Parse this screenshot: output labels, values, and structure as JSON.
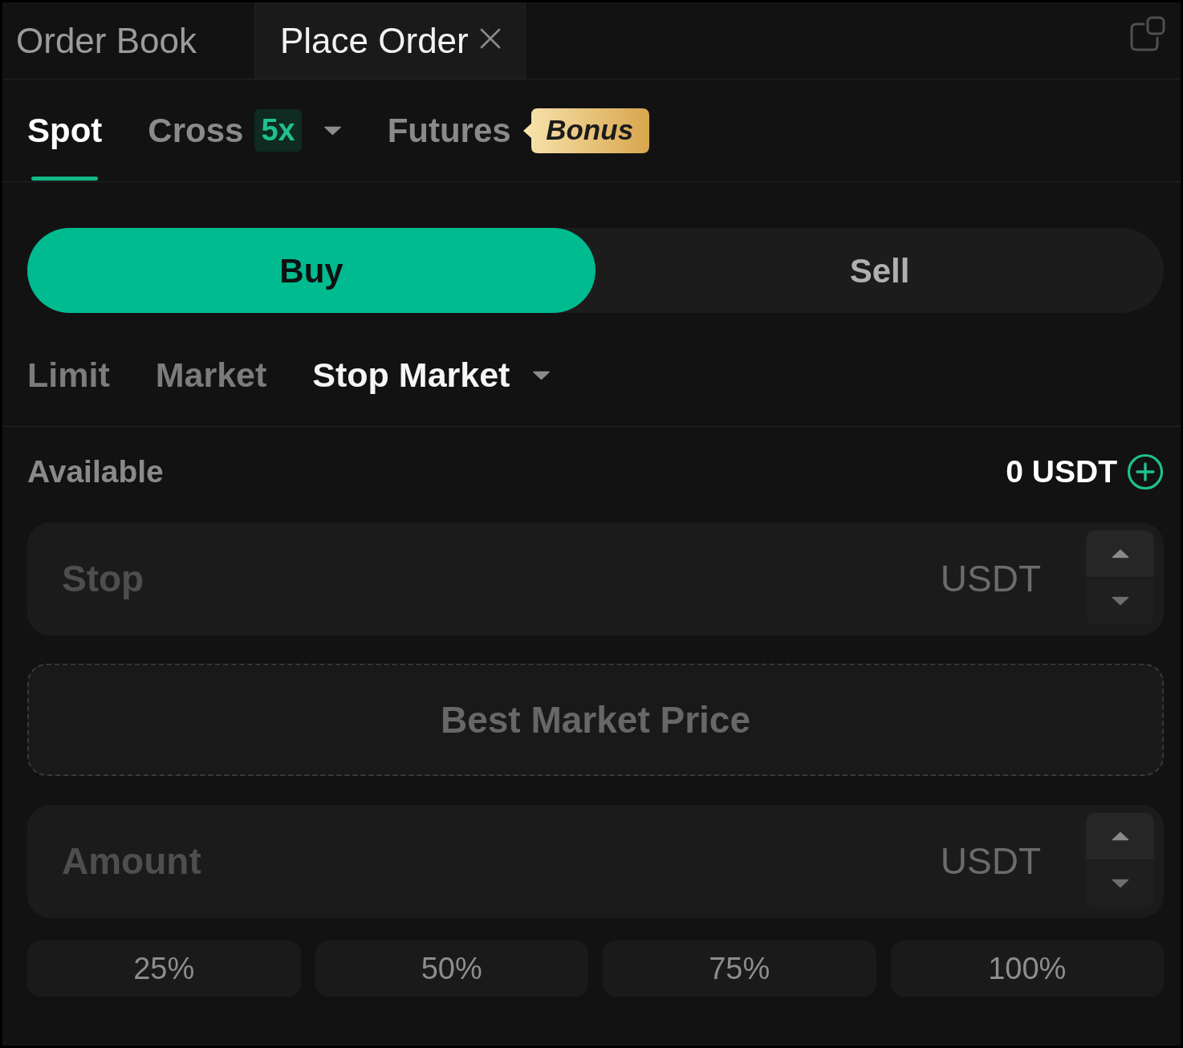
{
  "panel_tabs": [
    {
      "label": "Order Book",
      "selected": false,
      "closable": false
    },
    {
      "label": "Place Order",
      "selected": true,
      "closable": true
    }
  ],
  "market_tabs": [
    {
      "label": "Spot",
      "selected": true
    },
    {
      "label": "Cross",
      "selected": false,
      "leverage": "5x",
      "dropdown": true
    },
    {
      "label": "Futures",
      "selected": false,
      "badge": "Bonus"
    }
  ],
  "side_toggle": [
    {
      "label": "Buy",
      "selected": true
    },
    {
      "label": "Sell",
      "selected": false
    }
  ],
  "order_types": [
    {
      "label": "Limit",
      "selected": false
    },
    {
      "label": "Market",
      "selected": false
    },
    {
      "label": "Stop Market",
      "selected": true,
      "dropdown": true
    }
  ],
  "available": {
    "label": "Available",
    "value": "0 USDT"
  },
  "fields": [
    {
      "kind": "input",
      "placeholder": "Stop",
      "unit": "USDT"
    },
    {
      "kind": "fixed",
      "text": "Best Market Price"
    },
    {
      "kind": "input",
      "placeholder": "Amount",
      "unit": "USDT"
    }
  ],
  "percent_buttons": [
    "25%",
    "50%",
    "75%",
    "100%"
  ]
}
